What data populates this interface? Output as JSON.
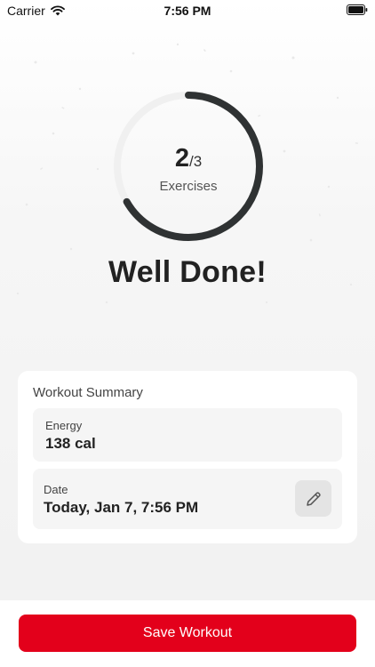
{
  "status_bar": {
    "carrier": "Carrier",
    "time": "7:56 PM"
  },
  "progress": {
    "completed": "2",
    "total": "/3",
    "unit": "Exercises",
    "fraction": 0.6667
  },
  "headline": "Well Done!",
  "summary": {
    "title": "Workout Summary",
    "energy_label": "Energy",
    "energy_value": "138 cal",
    "date_label": "Date",
    "date_value": "Today, Jan 7, 7:56 PM"
  },
  "actions": {
    "save_label": "Save Workout"
  },
  "colors": {
    "accent": "#e3001b",
    "ring_progress": "#2f3233",
    "ring_track": "#f0f0f0"
  }
}
